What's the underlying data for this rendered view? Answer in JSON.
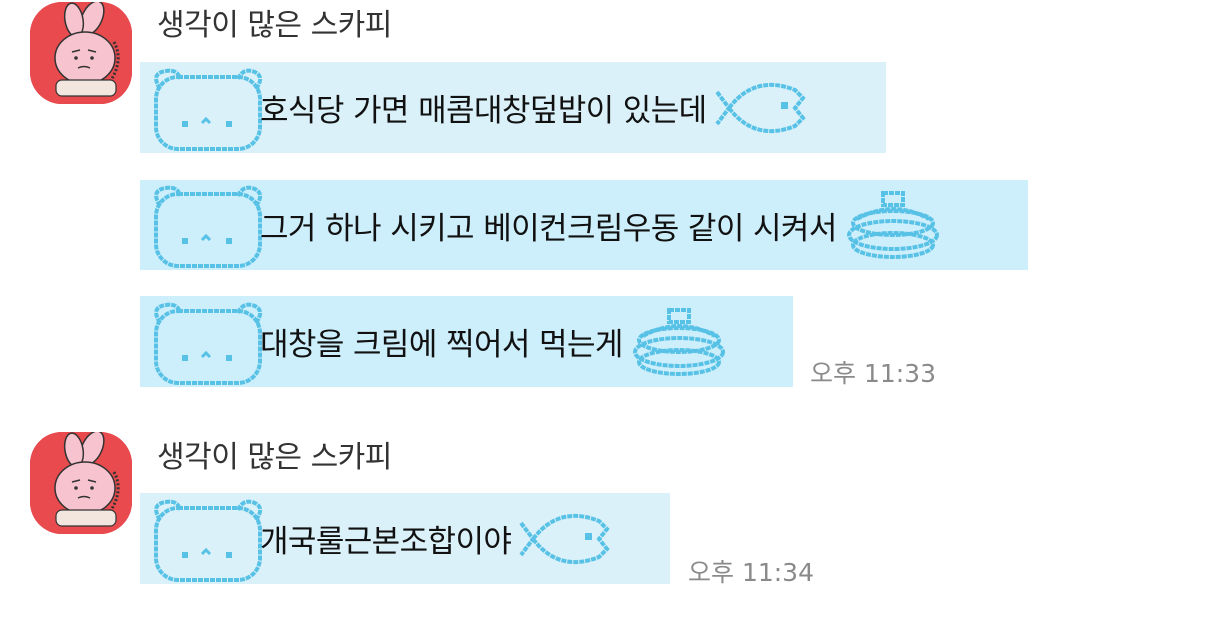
{
  "chat": {
    "groups": [
      {
        "sender": "생각이 많은 스카피",
        "messages": [
          {
            "text": "호식당 가면 매콤대창덮밥이 있는데",
            "deco": "fish-icon",
            "time": ""
          },
          {
            "text": "그거 하나 시키고 베이컨크림우동 같이 시켜서",
            "deco": "pancake-icon",
            "time": ""
          },
          {
            "text": "대창을 크림에 찍어서 먹는게",
            "deco": "pancake-icon",
            "time": "오후 11:33"
          }
        ]
      },
      {
        "sender": "생각이 많은 스카피",
        "messages": [
          {
            "text": "개국룰근본조합이야",
            "deco": "fish-icon",
            "time": "오후 11:34"
          }
        ]
      }
    ]
  },
  "colors": {
    "bubble": "#dbf1f9",
    "bubble_alt": "#cdeefb",
    "pixel_outline": "#58c2e6",
    "avatar_bg": "#e84a4e"
  }
}
